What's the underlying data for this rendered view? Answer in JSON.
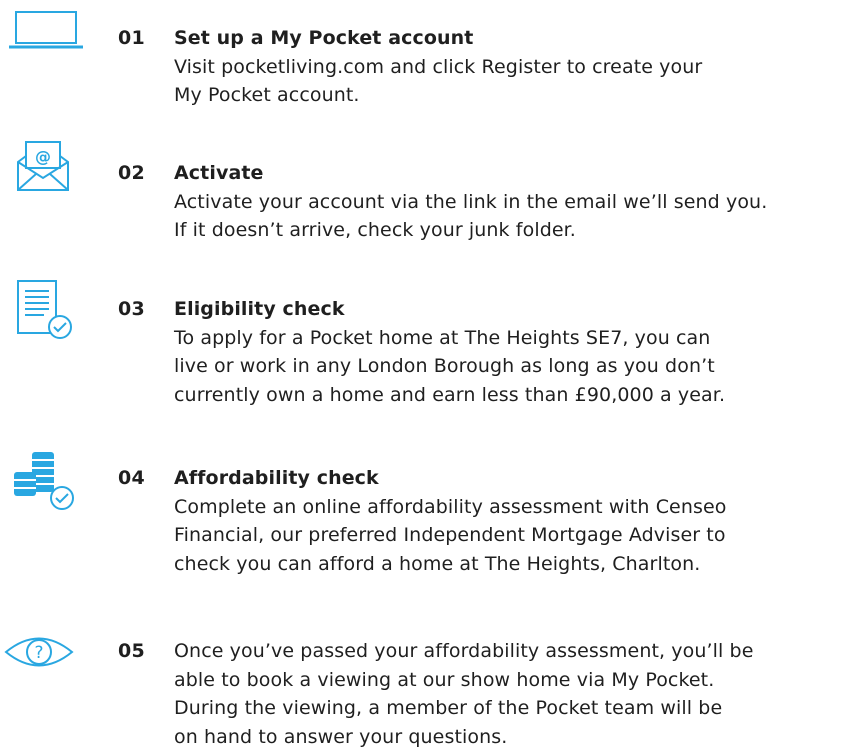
{
  "accent_color": "#29a7e1",
  "steps": [
    {
      "number": "01",
      "title": "Set up a My Pocket account",
      "icon": "laptop-icon",
      "lines": [
        "Visit pocketliving.com and click Register to create your",
        "My Pocket account."
      ]
    },
    {
      "number": "02",
      "title": "Activate",
      "icon": "email-envelope-icon",
      "lines": [
        "Activate your account via the link in the email we’ll send you.",
        "If it doesn’t arrive, check your junk folder."
      ]
    },
    {
      "number": "03",
      "title": "Eligibility check",
      "icon": "document-check-icon",
      "lines": [
        "To apply for a Pocket home at The Heights SE7, you can",
        "live or work in any London Borough as long as you don’t",
        "currently own a home and earn less than £90,000 a year."
      ]
    },
    {
      "number": "04",
      "title": "Affordability check",
      "icon": "coins-check-icon",
      "lines": [
        "Complete an online affordability assessment with Censeo",
        "Financial, our preferred Independent Mortgage Adviser to",
        "check you can afford a home at The Heights, Charlton."
      ]
    },
    {
      "number": "05",
      "title": "",
      "icon": "eye-question-icon",
      "lines": [
        "Once you’ve passed your affordability assessment, you’ll be",
        "able to book a viewing at our show home via My Pocket.",
        "During the viewing, a member of the Pocket team will be",
        "on hand to answer your questions."
      ]
    }
  ]
}
